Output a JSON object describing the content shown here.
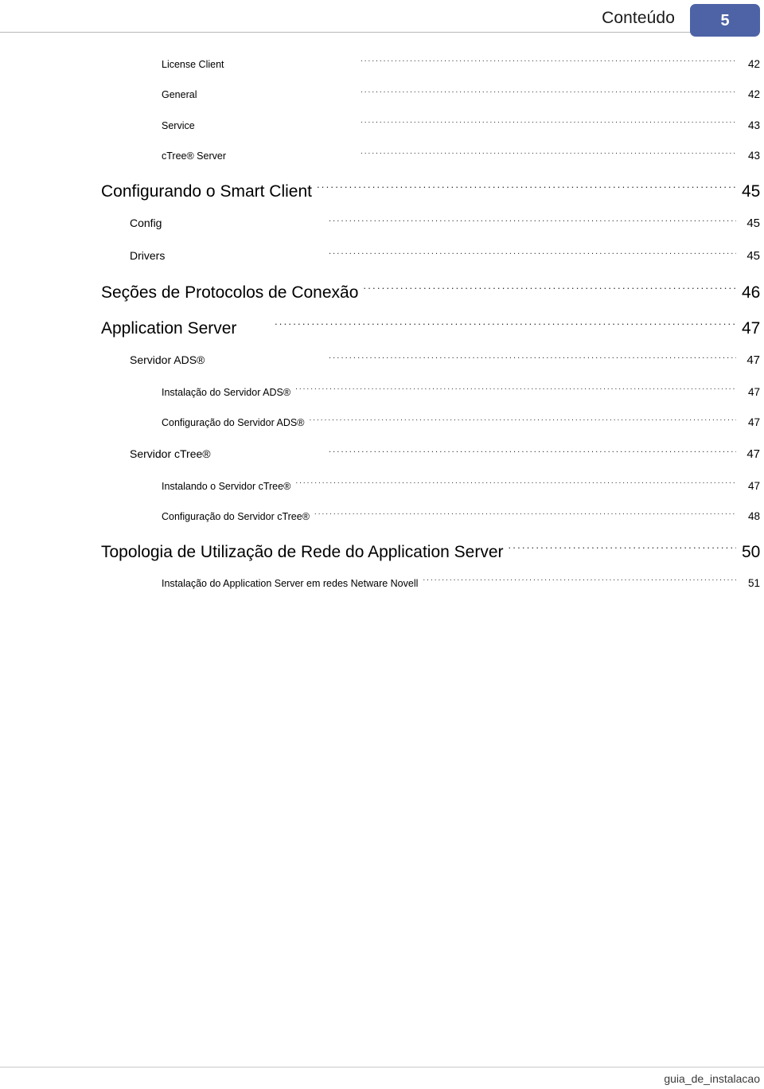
{
  "header": {
    "title": "Conteúdo",
    "page_badge": "5",
    "badge_color": "#4e63a5"
  },
  "toc": {
    "entries": [
      {
        "label": "License Client",
        "page": "42",
        "level": 3,
        "fixed_gap": true
      },
      {
        "label": "General",
        "page": "42",
        "level": 3,
        "fixed_gap": true
      },
      {
        "label": "Service",
        "page": "43",
        "level": 3,
        "fixed_gap": true
      },
      {
        "label": "cTree® Server",
        "page": "43",
        "level": 3,
        "fixed_gap": true
      },
      {
        "label": "Configurando o Smart Client",
        "page": "45",
        "level": 1,
        "fixed_gap": false
      },
      {
        "label": "Config",
        "page": "45",
        "level": 2,
        "fixed_gap": true
      },
      {
        "label": "Drivers",
        "page": "45",
        "level": 2,
        "fixed_gap": true
      },
      {
        "label": "Seções de Protocolos de Conexão",
        "page": "46",
        "level": 1,
        "fixed_gap": false
      },
      {
        "label": "Application Server",
        "page": "47",
        "level": 1,
        "fixed_gap": true
      },
      {
        "label": "Servidor ADS®",
        "page": "47",
        "level": 2,
        "fixed_gap": true
      },
      {
        "label": "Instalação do Servidor ADS®",
        "page": "47",
        "level": 3,
        "fixed_gap": false
      },
      {
        "label": "Configuração do Servidor ADS®",
        "page": "47",
        "level": 3,
        "fixed_gap": false
      },
      {
        "label": "Servidor cTree®",
        "page": "47",
        "level": 2,
        "fixed_gap": true
      },
      {
        "label": "Instalando o Servidor cTree®",
        "page": "47",
        "level": 3,
        "fixed_gap": false
      },
      {
        "label": "Configuração do Servidor cTree®",
        "page": "48",
        "level": 3,
        "fixed_gap": false
      },
      {
        "label": "Topologia de Utilização de Rede do Application Server",
        "page": "50",
        "level": 1,
        "fixed_gap": false
      },
      {
        "label": "Instalação do Application Server em redes Netware Novell",
        "page": "51",
        "level": 3,
        "fixed_gap": false
      }
    ]
  },
  "footer": {
    "text": "guia_de_instalacao"
  }
}
